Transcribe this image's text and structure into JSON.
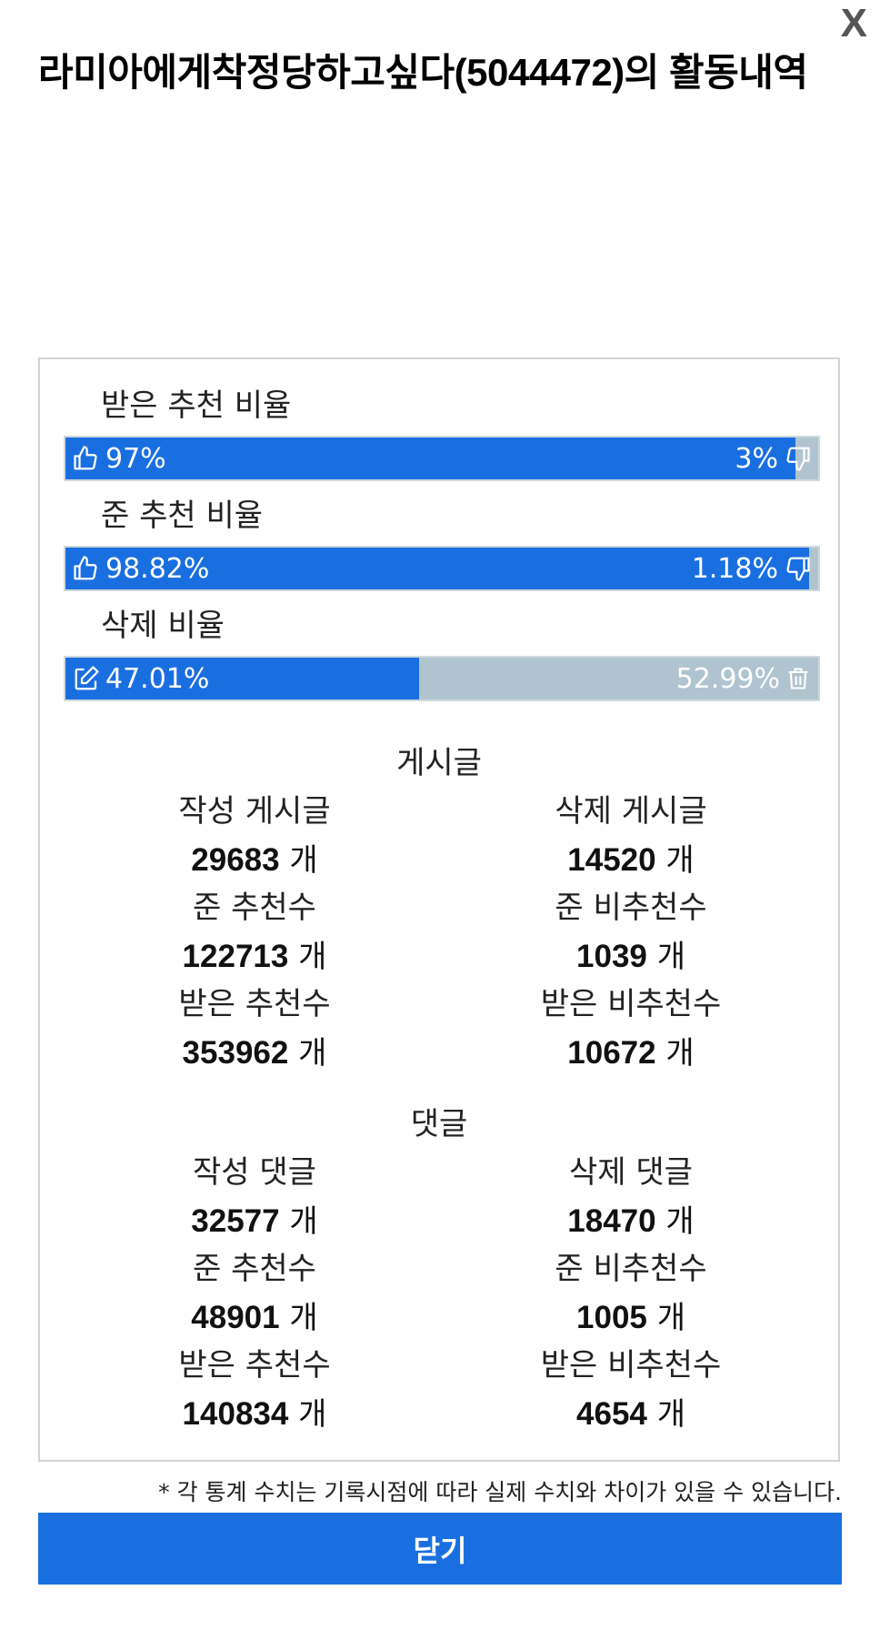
{
  "header": {
    "title": "라미아에게착정당하고싶다(5044472)의 활동내역",
    "close_label": "X"
  },
  "ratios": [
    {
      "label": "받은 추천 비율",
      "left_value": "97%",
      "right_value": "3%",
      "fill_fraction": 0.97,
      "left_icon": "thumbs-up-icon",
      "right_icon": "thumbs-down-icon"
    },
    {
      "label": "준 추천 비율",
      "left_value": "98.82%",
      "right_value": "1.18%",
      "fill_fraction": 0.9882,
      "left_icon": "thumbs-up-icon",
      "right_icon": "thumbs-down-icon"
    },
    {
      "label": "삭제 비율",
      "left_value": "47.01%",
      "right_value": "52.99%",
      "fill_fraction": 0.4701,
      "left_icon": "edit-icon",
      "right_icon": "trash-icon"
    }
  ],
  "posts": {
    "heading": "게시글",
    "stats": [
      {
        "label": "작성 게시글",
        "value": "29683"
      },
      {
        "label": "삭제 게시글",
        "value": "14520"
      },
      {
        "label": "준 추천수",
        "value": "122713"
      },
      {
        "label": "준 비추천수",
        "value": "1039"
      },
      {
        "label": "받은 추천수",
        "value": "353962"
      },
      {
        "label": "받은 비추천수",
        "value": "10672"
      }
    ]
  },
  "comments": {
    "heading": "댓글",
    "stats": [
      {
        "label": "작성 댓글",
        "value": "32577"
      },
      {
        "label": "삭제 댓글",
        "value": "18470"
      },
      {
        "label": "준 추천수",
        "value": "48901"
      },
      {
        "label": "준 비추천수",
        "value": "1005"
      },
      {
        "label": "받은 추천수",
        "value": "140834"
      },
      {
        "label": "받은 비추천수",
        "value": "4654"
      }
    ]
  },
  "unit": "개",
  "note": "* 각 통계 수치는 기록시점에 따라 실제 수치와 차이가 있을 수 있습니다.",
  "footer": {
    "close_button": "닫기"
  },
  "colors": {
    "accent": "#1a6fe0",
    "bar_remainder": "#b0c4cf",
    "panel_border": "#cfd3d6"
  }
}
